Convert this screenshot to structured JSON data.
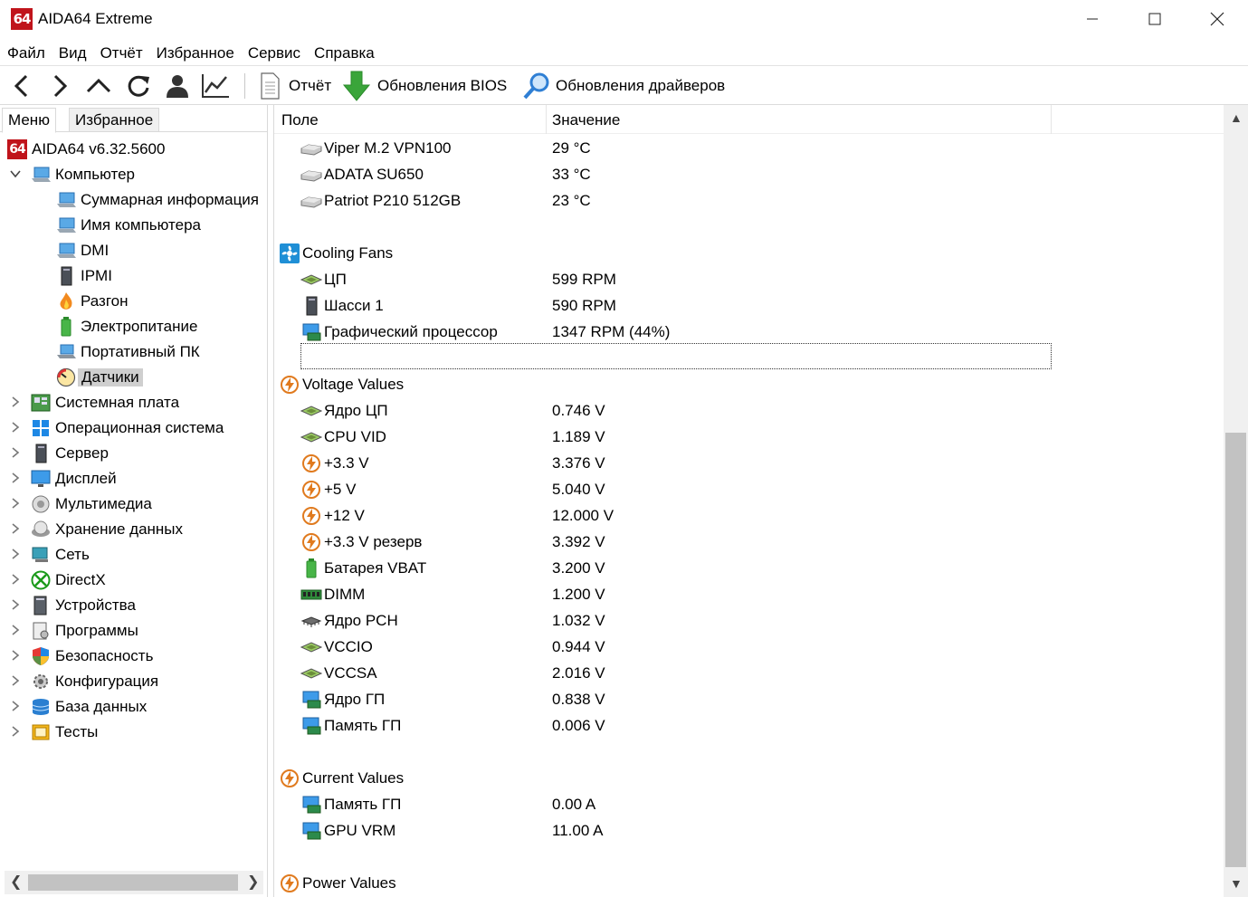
{
  "window": {
    "logo_text": "64",
    "title": "AIDA64 Extreme"
  },
  "menu": [
    "Файл",
    "Вид",
    "Отчёт",
    "Избранное",
    "Сервис",
    "Справка"
  ],
  "toolbar": {
    "report_label": "Отчёт",
    "bios_update_label": "Обновления BIOS",
    "driver_update_label": "Обновления драйверов"
  },
  "left_panel": {
    "tabs": [
      "Меню",
      "Избранное"
    ],
    "tree": [
      {
        "label": "AIDA64 v6.32.5600",
        "icon": "aida64-logo-icon"
      },
      {
        "label": "Компьютер",
        "icon": "computer-icon"
      },
      {
        "label": "Суммарная информация",
        "icon": "computer-icon"
      },
      {
        "label": "Имя компьютера",
        "icon": "computer-icon"
      },
      {
        "label": "DMI",
        "icon": "computer-icon"
      },
      {
        "label": "IPMI",
        "icon": "server-tower-icon"
      },
      {
        "label": "Разгон",
        "icon": "flame-icon"
      },
      {
        "label": "Электропитание",
        "icon": "battery-icon"
      },
      {
        "label": "Портативный ПК",
        "icon": "laptop-icon"
      },
      {
        "label": "Датчики",
        "icon": "gauge-icon"
      },
      {
        "label": "Системная плата",
        "icon": "motherboard-icon"
      },
      {
        "label": "Операционная система",
        "icon": "windows-icon"
      },
      {
        "label": "Сервер",
        "icon": "server-tower-icon"
      },
      {
        "label": "Дисплей",
        "icon": "monitor-icon"
      },
      {
        "label": "Мультимедиа",
        "icon": "speaker-icon"
      },
      {
        "label": "Хранение данных",
        "icon": "disk-icon"
      },
      {
        "label": "Сеть",
        "icon": "network-icon"
      },
      {
        "label": "DirectX",
        "icon": "xbox-icon"
      },
      {
        "label": "Устройства",
        "icon": "devices-icon"
      },
      {
        "label": "Программы",
        "icon": "programs-icon"
      },
      {
        "label": "Безопасность",
        "icon": "shield-icon"
      },
      {
        "label": "Конфигурация",
        "icon": "config-icon"
      },
      {
        "label": "База данных",
        "icon": "database-icon"
      },
      {
        "label": "Тесты",
        "icon": "benchmark-icon"
      }
    ]
  },
  "table": {
    "col_field": "Поле",
    "col_value": "Значение",
    "rows": [
      {
        "field": "Viper M.2 VPN100",
        "value": "29 °C",
        "icon": "drive-icon"
      },
      {
        "field": "ADATA SU650",
        "value": "33 °C",
        "icon": "drive-icon"
      },
      {
        "field": "Patriot P210 512GB",
        "value": "23 °C",
        "icon": "drive-icon"
      },
      {
        "section": "Cooling Fans",
        "icon": "fan-icon"
      },
      {
        "field": "ЦП",
        "value": "599 RPM",
        "icon": "cpu-icon"
      },
      {
        "field": "Шасси 1",
        "value": "590 RPM",
        "icon": "server-tower-icon"
      },
      {
        "field": "Графический процессор",
        "value": "1347 RPM  (44%)",
        "icon": "gpu-icon"
      },
      {
        "section": "Voltage Values",
        "icon": "voltage-icon"
      },
      {
        "field": "Ядро ЦП",
        "value": "0.746 V",
        "icon": "cpu-icon"
      },
      {
        "field": "CPU VID",
        "value": "1.189 V",
        "icon": "cpu-icon"
      },
      {
        "field": "+3.3 V",
        "value": "3.376 V",
        "icon": "voltage-icon"
      },
      {
        "field": "+5 V",
        "value": "5.040 V",
        "icon": "voltage-icon"
      },
      {
        "field": "+12 V",
        "value": "12.000 V",
        "icon": "voltage-icon"
      },
      {
        "field": "+3.3 V резерв",
        "value": "3.392 V",
        "icon": "voltage-icon"
      },
      {
        "field": "Батарея VBAT",
        "value": "3.200 V",
        "icon": "battery-icon"
      },
      {
        "field": "DIMM",
        "value": "1.200 V",
        "icon": "ram-icon"
      },
      {
        "field": "Ядро PCH",
        "value": "1.032 V",
        "icon": "chip-icon"
      },
      {
        "field": "VCCIO",
        "value": "0.944 V",
        "icon": "cpu-icon"
      },
      {
        "field": "VCCSA",
        "value": "2.016 V",
        "icon": "cpu-icon"
      },
      {
        "field": "Ядро ГП",
        "value": "0.838 V",
        "icon": "gpu-icon"
      },
      {
        "field": "Память ГП",
        "value": "0.006 V",
        "icon": "gpu-icon"
      },
      {
        "section": "Current Values",
        "icon": "voltage-icon"
      },
      {
        "field": "Память ГП",
        "value": "0.00 A",
        "icon": "gpu-icon"
      },
      {
        "field": "GPU VRM",
        "value": "11.00 A",
        "icon": "gpu-icon"
      },
      {
        "section": "Power Values",
        "icon": "voltage-icon"
      }
    ]
  },
  "colors": {
    "logo_red": "#c0141b",
    "selection_gray": "#cfcfcf",
    "toolbar_green": "#3aa53a",
    "magnifier_blue": "#2f7fd4"
  }
}
